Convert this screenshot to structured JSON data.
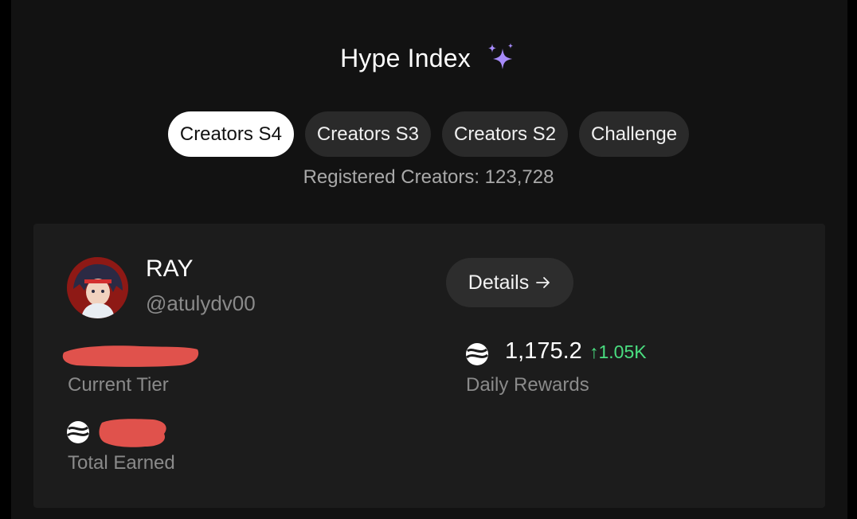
{
  "header": {
    "title": "Hype Index",
    "sparkle_icon": "sparkles-icon",
    "sparkle_color": "#a78bfa"
  },
  "tabs": [
    {
      "label": "Creators S4",
      "active": true
    },
    {
      "label": "Creators S3",
      "active": false
    },
    {
      "label": "Creators S2",
      "active": false
    },
    {
      "label": "Challenge",
      "active": false
    }
  ],
  "registered": "Registered Creators: 123,728",
  "profile": {
    "name": "RAY",
    "handle": "@atulydv00",
    "details_label": "Details",
    "details_icon": "arrow-right-icon"
  },
  "stats": {
    "current_tier_label": "Current Tier",
    "total_earned_label": "Total Earned",
    "daily_rewards_label": "Daily Rewards",
    "daily_rewards_value": "1,175.2",
    "daily_rewards_change": "↑1.05K",
    "change_color": "#4ade80",
    "redaction_color": "#e0524c"
  }
}
